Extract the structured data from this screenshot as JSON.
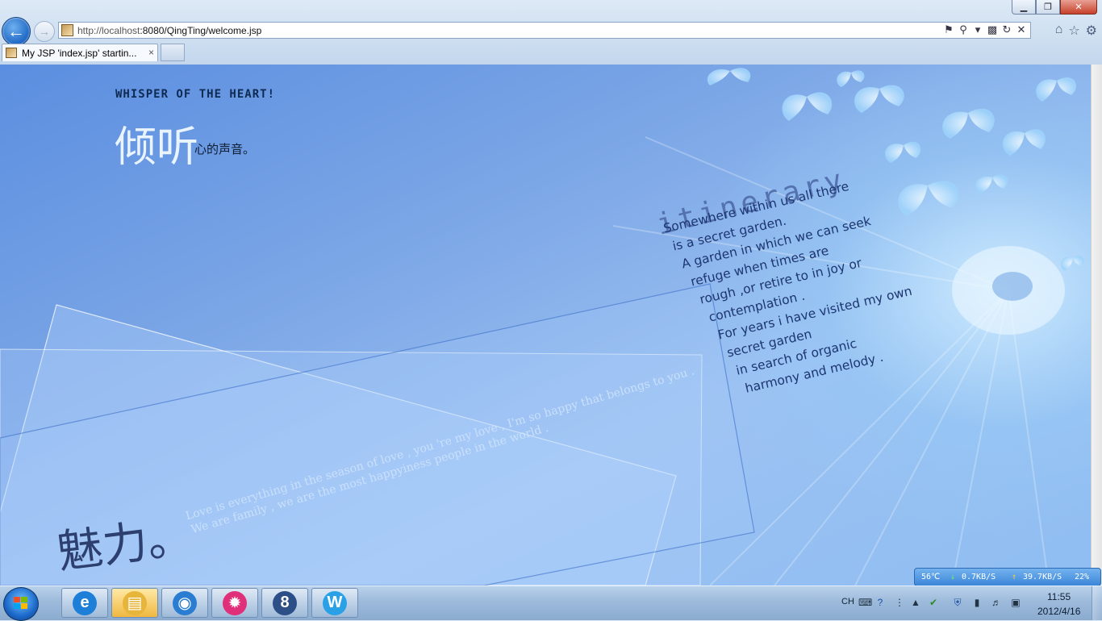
{
  "browser": {
    "url_host": "http://localhost",
    "url_path": ":8080/QingTing/welcome.jsp",
    "tab_title": "My JSP 'index.jsp' startin...",
    "tab_close": "×",
    "window_controls": {
      "minimize": "▁",
      "maximize": "❐",
      "close": "✕"
    },
    "address_tools": [
      "compat-view-icon",
      "search-icon",
      "dropdown-icon",
      "rss-icon",
      "refresh-icon",
      "stop-icon"
    ],
    "nav_tools": [
      "home-icon",
      "favorites-icon",
      "tools-icon"
    ]
  },
  "page": {
    "whisper": "WHISPER OF THE HEART!",
    "title_big": "倾听",
    "title_small": "心的声音。",
    "itinerary": "itinerary",
    "poem": [
      "Somewhere within us all there",
      "is a secret garden.",
      "A garden in which we can seek",
      "refuge when times are",
      "rough ,or retire to in joy or",
      "contemplation .",
      "For years i have visited my own",
      "secret garden",
      "in search of organic",
      "harmony and melody ."
    ],
    "meili": "魅力。",
    "love_line1": "Love is everything in the season of love , you 're my love , I'm so happy that belongs to you .",
    "love_line2": "We are family , we are the most happyiness people in the world ."
  },
  "netmon": {
    "temp": "56℃",
    "down_speed": "0.7KB/S",
    "up_speed": "39.7KB/S",
    "cpu": "22%"
  },
  "taskbar": {
    "apps": [
      {
        "name": "internet-explorer",
        "glyph": "e",
        "color": "#1e7fd8"
      },
      {
        "name": "file-explorer",
        "glyph": "▤",
        "color": "#e7b53a"
      },
      {
        "name": "globe-app",
        "glyph": "◉",
        "color": "#2a7dd1"
      },
      {
        "name": "pinwheel-app",
        "glyph": "✹",
        "color": "#e0307a"
      },
      {
        "name": "eclipse-like-app",
        "glyph": "8",
        "color": "#2b4f86"
      },
      {
        "name": "word-app",
        "glyph": "W",
        "color": "#2aa1e6"
      }
    ],
    "lang": "CH",
    "time": "11:55",
    "date": "2012/4/16"
  }
}
